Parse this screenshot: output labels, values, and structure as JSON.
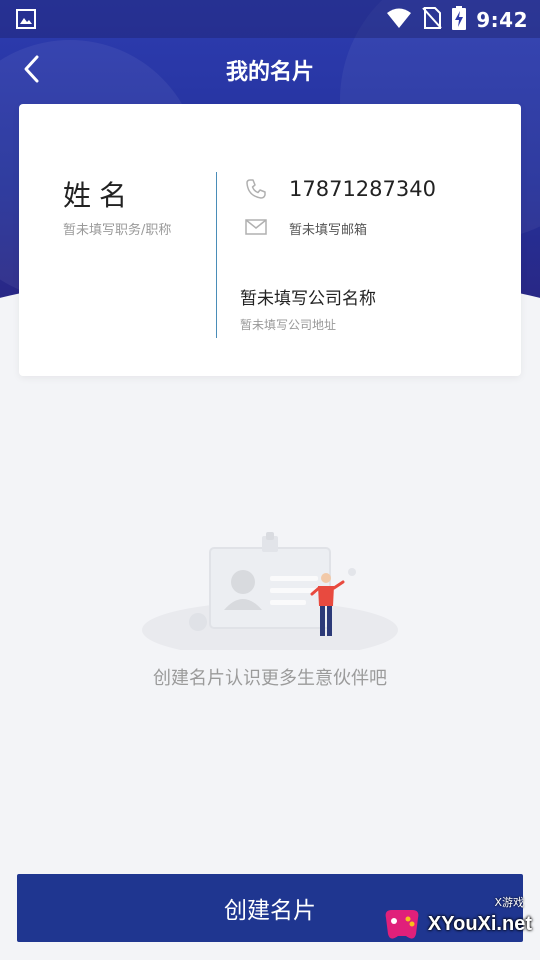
{
  "status_bar": {
    "time": "9:42",
    "icons": [
      "gallery-icon",
      "wifi-icon",
      "no-sim-icon",
      "battery-charging-icon"
    ]
  },
  "header": {
    "title": "我的名片",
    "back_icon": "back-arrow-icon"
  },
  "card": {
    "name": "姓名",
    "job_placeholder": "暂未填写职务/职称",
    "phone": "17871287340",
    "email_placeholder": "暂未填写邮箱",
    "company_placeholder": "暂未填写公司名称",
    "address_placeholder": "暂未填写公司地址",
    "divider_color": "#4a8db8"
  },
  "empty_state": {
    "illustration": "business-card-person-illustration",
    "text": "创建名片认识更多生意伙伴吧"
  },
  "create_button": {
    "label": "创建名片",
    "color": "#1f3690"
  },
  "watermark": {
    "text": "XYouXi.net",
    "tag": "X游戏"
  },
  "theme": {
    "header_gradient_top": "#2d3cb0",
    "header_gradient_bottom": "#2a2580",
    "background": "#f3f4f7"
  }
}
